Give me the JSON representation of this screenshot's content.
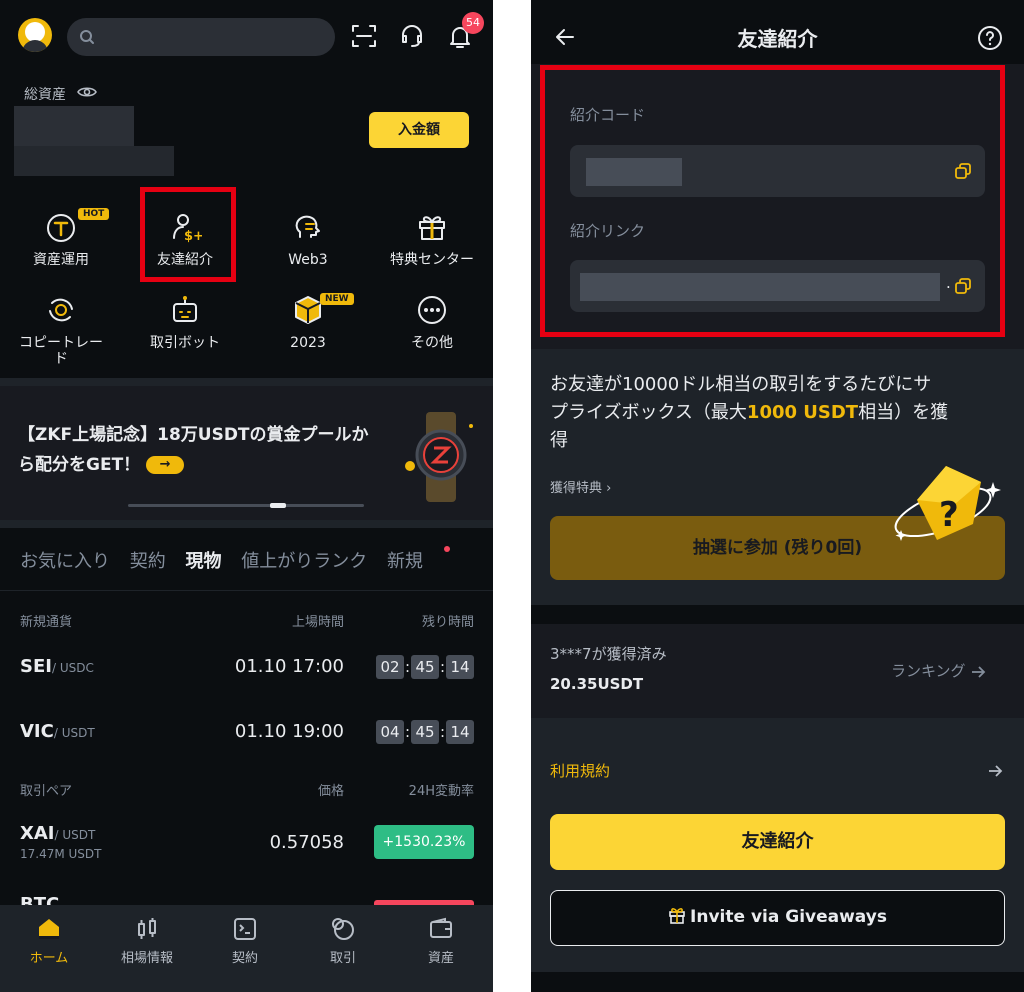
{
  "left": {
    "notification_count": "54",
    "assets_label": "総資産",
    "deposit_label": "入金額",
    "grid": [
      {
        "label": "資産運用",
        "tag": "HOT"
      },
      {
        "label": "友達紹介"
      },
      {
        "label": "Web3"
      },
      {
        "label": "特典センター"
      },
      {
        "label_line1": "コピートレー",
        "label_line2": "ド"
      },
      {
        "label": "取引ボット"
      },
      {
        "label": "2023",
        "tag": "NEW"
      },
      {
        "label": "その他"
      }
    ],
    "promo": {
      "line1": "【ZKF上場記念】18万USDTの賞金プールか",
      "line2": "ら配分をGET！",
      "arrow": "→"
    },
    "tabs": [
      "お気に入り",
      "契約",
      "現物",
      "値上がりランク",
      "新規"
    ],
    "new_listing": {
      "headers": [
        "新規通貨",
        "上場時間",
        "残り時間"
      ],
      "rows": [
        {
          "base": "SEI",
          "quote": "/ USDC",
          "time": "01.10 17:00",
          "h": "02",
          "m": "45",
          "s": "14"
        },
        {
          "base": "VIC",
          "quote": "/ USDT",
          "time": "01.10 19:00",
          "h": "04",
          "m": "45",
          "s": "14"
        }
      ]
    },
    "pairs": {
      "headers": [
        "取引ペア",
        "価格",
        "24H変動率"
      ],
      "rows": [
        {
          "base": "XAI",
          "quote": "/ USDT",
          "volume": "17.47M USDT",
          "price": "0.57058",
          "change": "+1530.23%"
        }
      ],
      "partial_row": "BTC"
    },
    "nav": [
      "ホーム",
      "相場情報",
      "契約",
      "取引",
      "資産"
    ],
    "colors": {
      "accent": "#f0b90b",
      "up": "#2ebd85",
      "down": "#f6465d",
      "highlight": "#e60012"
    }
  },
  "right": {
    "title": "友達紹介",
    "code_label": "紹介コード",
    "link_label": "紹介リンク",
    "link_suffix": ".",
    "desc_part1": "お友達が10000ドル相当の取引をするたびにサ",
    "desc_part2": "プライズボックス（最大",
    "desc_highlight": "1000 USDT",
    "desc_part3": "相当）を獲",
    "desc_part4": "得",
    "rewards_link": "獲得特典 ›",
    "lottery_btn": "抽選に参加 (残り0回)",
    "winner_text": "3***7が獲得済み",
    "winner_amount": "20.35USDT",
    "ranking_link": "ランキング",
    "terms_label": "利用規約",
    "refer_btn": "友達紹介",
    "giveaway_btn": "Invite via Giveaways"
  }
}
